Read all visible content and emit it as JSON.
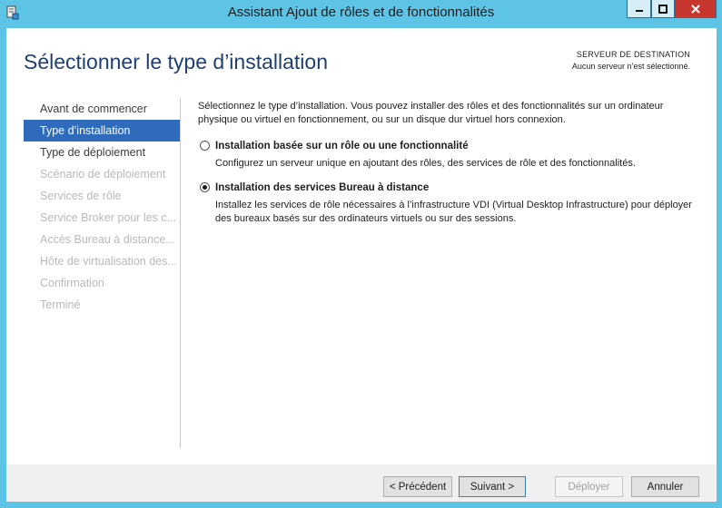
{
  "window": {
    "title": "Assistant Ajout de rôles et de fonctionnalités",
    "controls": {
      "minimize": "minimize-icon",
      "maximize": "maximize-icon",
      "close": "close-icon"
    },
    "app_icon": "server-manager-icon"
  },
  "header": {
    "title": "Sélectionner le type d’installation",
    "destination_label": "SERVEUR DE DESTINATION",
    "destination_value": "Aucun serveur n’est sélectionné."
  },
  "nav": {
    "items": [
      {
        "label": "Avant de commencer",
        "state": "normal"
      },
      {
        "label": "Type d’installation",
        "state": "active"
      },
      {
        "label": "Type de déploiement",
        "state": "normal"
      },
      {
        "label": "Scénario de déploiement",
        "state": "disabled"
      },
      {
        "label": "Services de rôle",
        "state": "disabled"
      },
      {
        "label": "Service Broker pour les c...",
        "state": "disabled"
      },
      {
        "label": "Accès Bureau à distance...",
        "state": "disabled"
      },
      {
        "label": "Hôte de virtualisation des...",
        "state": "disabled"
      },
      {
        "label": "Confirmation",
        "state": "disabled"
      },
      {
        "label": "Terminé",
        "state": "disabled"
      }
    ]
  },
  "content": {
    "intro": "Sélectionnez le type d’installation. Vous pouvez installer des rôles et des fonctionnalités sur un ordinateur physique ou virtuel en fonctionnement, ou sur un disque dur virtuel hors connexion.",
    "options": [
      {
        "title": "Installation basée sur un rôle ou une fonctionnalité",
        "description": "Configurez un serveur unique en ajoutant des rôles, des services de rôle et des fonctionnalités.",
        "selected": false
      },
      {
        "title": "Installation des services Bureau à distance",
        "description": "Installez les services de rôle nécessaires à l’infrastructure VDI (Virtual Desktop Infrastructure) pour déployer des bureaux basés sur des ordinateurs virtuels ou sur des sessions.",
        "selected": true
      }
    ]
  },
  "footer": {
    "previous": "< Précédent",
    "next": "Suivant >",
    "deploy": "Déployer",
    "cancel": "Annuler"
  },
  "colors": {
    "chrome": "#5ec4e6",
    "title_text": "#1f3f70",
    "nav_active": "#2f6bbc",
    "close_button": "#c7372f"
  }
}
